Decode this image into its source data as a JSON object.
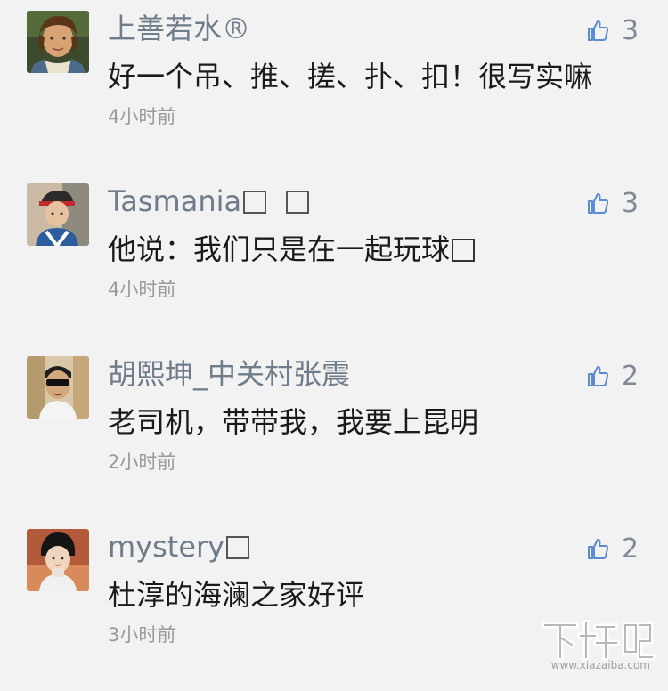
{
  "comments": [
    {
      "username": "上善若水®",
      "text": "好一个吊、推、搓、扑、扣！很写实嘛",
      "time": "4小时前",
      "likes": "3",
      "avatar": "rapunzel-flynn-avatar",
      "name_boxes": 0,
      "text_boxes": 0
    },
    {
      "username": "Tasmania",
      "text": "他说：我们只是在一起玩球",
      "time": "4小时前",
      "likes": "3",
      "avatar": "child-cap-avatar",
      "name_boxes": 2,
      "text_boxes": 1
    },
    {
      "username": "胡熙坤_中关村张震",
      "text": "老司机，带带我，我要上昆明",
      "time": "2小时前",
      "likes": "2",
      "avatar": "sunglasses-man-avatar",
      "name_boxes": 0,
      "text_boxes": 0
    },
    {
      "username": "mystery",
      "text": "杜淳的海澜之家好评",
      "time": "3小时前",
      "likes": "2",
      "avatar": "woman-photo-avatar",
      "name_boxes": 1,
      "text_boxes": 0
    }
  ],
  "watermark": {
    "logo": "下载吧",
    "url": "www.xiazaiba.com"
  },
  "colors": {
    "background": "#f2f2f2",
    "username": "#6f7c8a",
    "content": "#1a1a1a",
    "time": "#9a9a9a",
    "like_icon": "#5b8bd0"
  }
}
